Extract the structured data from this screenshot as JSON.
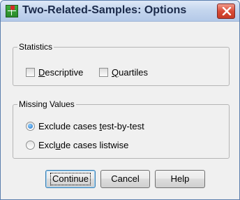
{
  "window": {
    "title": "Two-Related-Samples: Options"
  },
  "statistics": {
    "legend": "Statistics",
    "descriptive": {
      "pre": "",
      "key": "D",
      "post": "escriptive",
      "checked": false
    },
    "quartiles": {
      "pre": "",
      "key": "Q",
      "post": "uartiles",
      "checked": false
    }
  },
  "missing_values": {
    "legend": "Missing Values",
    "test_by_test": {
      "pre": "Exclude cases ",
      "key": "t",
      "post": "est-by-test",
      "selected": true
    },
    "listwise": {
      "pre": "Excl",
      "key": "u",
      "post": "de cases listwise",
      "selected": false
    }
  },
  "buttons": {
    "continue": "Continue",
    "cancel": "Cancel",
    "help": "Help"
  },
  "icons": {
    "app": "spss-data-grid-icon",
    "close": "close-icon"
  },
  "colors": {
    "close_button": "#d94b37",
    "title_bar": "#c5d6ee",
    "default_button_border": "#3c7fb1"
  }
}
